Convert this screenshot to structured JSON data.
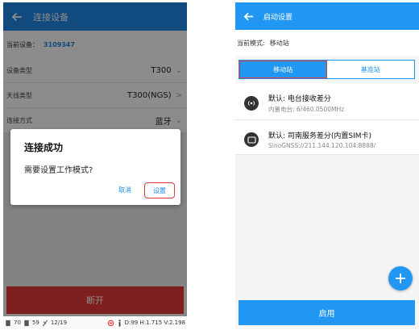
{
  "left_screen": {
    "title": "连接设备",
    "current_device_label": "当前设备：",
    "current_device_value": "3109347",
    "rows": [
      {
        "label": "设备类型",
        "value": "T300",
        "arrow": "⌄"
      },
      {
        "label": "天线类型",
        "value": "T300(NGS)",
        "arrow": ">"
      },
      {
        "label": "连接方式",
        "value": "蓝牙",
        "arrow": "⌄"
      }
    ],
    "dialog": {
      "title": "连接成功",
      "message": "需要设置工作模式?",
      "cancel_label": "取消",
      "ok_label": "设置"
    },
    "disconnect_label": "断开",
    "status_bar": {
      "left_a": "70",
      "left_b": "59",
      "left_c": "12/19",
      "right_text": "D:99 H:1.715 V:2.198"
    }
  },
  "right_screen": {
    "title": "启动设置",
    "mode_label": "当前模式:",
    "mode_value": "移动站",
    "tabs": [
      {
        "label": "移动站",
        "active": true
      },
      {
        "label": "基准站",
        "active": false
      }
    ],
    "items": [
      {
        "icon": "radio-icon",
        "title": "默认: 电台接收差分",
        "subtitle": "内置电台: 6/460.0500MHz"
      },
      {
        "icon": "sim-card-icon",
        "title": "默认: 司南服务差分(内置SIM卡)",
        "subtitle": "SinoGNSS://211.144.120.104:8888/"
      }
    ],
    "start_label": "启用"
  },
  "colors": {
    "primary_blue": "#2196f3",
    "danger_red": "#e53935"
  }
}
